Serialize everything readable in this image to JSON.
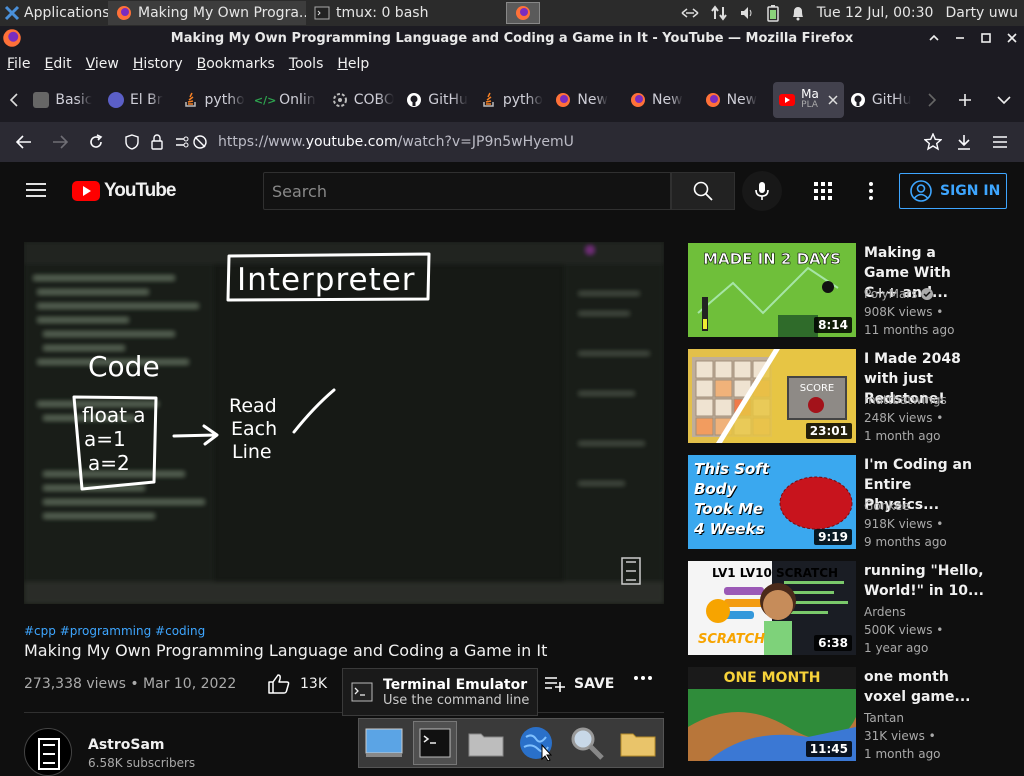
{
  "panel": {
    "applications_label": "Applications",
    "tasks": [
      {
        "label": "Making My Own Progra...",
        "icon": "firefox-icon"
      },
      {
        "label": "tmux: 0 bash",
        "icon": "terminal-icon"
      }
    ],
    "datetime": "Tue 12 Jul, 00:30",
    "user": "Darty uwu"
  },
  "window": {
    "title": "Making My Own Programming Language and Coding a Game in It - YouTube — Mozilla Firefox"
  },
  "menubar": [
    "File",
    "Edit",
    "View",
    "History",
    "Bookmarks",
    "Tools",
    "Help"
  ],
  "tabs": [
    {
      "label": "Basic",
      "icon": "page-icon",
      "color": "#888888"
    },
    {
      "label": "El Br",
      "icon": "mascot-icon",
      "color": "#5b5fc7"
    },
    {
      "label": "pytho",
      "icon": "stackoverflow-icon",
      "color": "#f48024"
    },
    {
      "label": "Onlin",
      "icon": "code-icon",
      "color": "#2ea44f"
    },
    {
      "label": "COBO",
      "icon": "gear-icon",
      "color": "#bbbbbb"
    },
    {
      "label": "GitHu",
      "icon": "github-icon",
      "color": "#ffffff"
    },
    {
      "label": "pytho",
      "icon": "stackoverflow-icon",
      "color": "#f48024"
    },
    {
      "label": "New",
      "icon": "firefox-icon",
      "color": "#ff7139"
    },
    {
      "label": "New",
      "icon": "firefox-icon",
      "color": "#ff7139"
    },
    {
      "label": "New",
      "icon": "firefox-icon",
      "color": "#ff7139"
    },
    {
      "label": "Ma",
      "sublabel": "PLA",
      "icon": "youtube-icon",
      "color": "#ff0000",
      "active": true
    },
    {
      "label": "GitHu",
      "icon": "github-icon",
      "color": "#ffffff"
    }
  ],
  "url": {
    "prefix": "https://www.",
    "domain": "youtube.com",
    "path": "/watch?v=JP9n5wHyemU"
  },
  "youtube": {
    "logo_text": "YouTube",
    "search_placeholder": "Search",
    "signin_label": "SIGN IN"
  },
  "video": {
    "board_title": "Interpreter",
    "board_code_heading": "Code",
    "board_code_lines": [
      "float a",
      "a=1",
      "a=2"
    ],
    "board_step": [
      "Read",
      "Each",
      "Line"
    ],
    "hashtags": "#cpp #programming #coding",
    "title": "Making My Own Programming Language and Coding a Game in It",
    "views_date": "273,338 views • Mar 10, 2022",
    "likes": "13K",
    "save_label": "SAVE",
    "channel": "AstroSam",
    "subscribers": "6.58K subscribers"
  },
  "tooltip": {
    "title": "Terminal Emulator",
    "subtitle": "Use the command line"
  },
  "recommendations": [
    {
      "title": "Making a Game With C++ and...",
      "channel": "PolyMars",
      "verified": true,
      "views": "908K views •",
      "age": "11 months ago",
      "duration": "8:14",
      "thumb_text": "MADE IN 2 DAYS"
    },
    {
      "title": "I Made 2048 with just Redstone!",
      "channel": "mattbatwings",
      "verified": false,
      "views": "248K views •",
      "age": "1 month ago",
      "duration": "23:01",
      "thumb_text": "SCORE"
    },
    {
      "title": "I'm Coding an Entire Physics...",
      "channel": "Gonkee",
      "verified": false,
      "views": "918K views •",
      "age": "9 months ago",
      "duration": "9:19",
      "thumb_text": "This Soft Body Took Me 4 Weeks"
    },
    {
      "title": "running \"Hello, World!\" in 10...",
      "channel": "Ardens",
      "verified": false,
      "views": "500K views •",
      "age": "1 year ago",
      "duration": "6:38",
      "thumb_text": "LV1 LV10 SCRATCH"
    },
    {
      "title": "one month voxel game...",
      "channel": "Tantan",
      "verified": false,
      "views": "31K views •",
      "age": "1 month ago",
      "duration": "11:45",
      "thumb_text": "ONE MONTH"
    }
  ]
}
